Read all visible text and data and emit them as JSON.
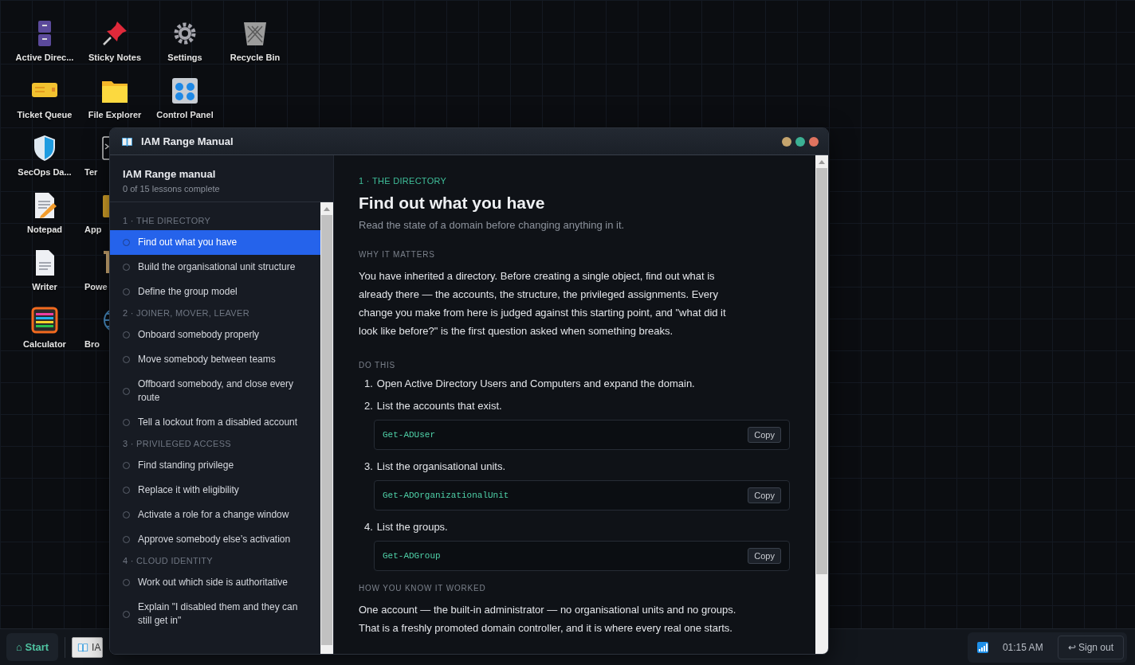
{
  "desktop_columns": [
    [
      {
        "label": "Active Direc...",
        "kind": "cabinet"
      },
      {
        "label": "Ticket Queue",
        "kind": "ticket"
      },
      {
        "label": "SecOps Da...",
        "kind": "shield"
      },
      {
        "label": "Notepad",
        "kind": "notepad"
      },
      {
        "label": "Writer",
        "kind": "document"
      },
      {
        "label": "Calculator",
        "kind": "abacus"
      }
    ],
    [
      {
        "label": "Sticky Notes",
        "kind": "pin",
        "partial": false
      },
      {
        "label": "File Explorer",
        "kind": "folder",
        "partial": false
      },
      {
        "label": "Ter",
        "kind": "terminal",
        "partial": true
      },
      {
        "label": "App",
        "kind": "box",
        "partial": true
      },
      {
        "label": "Powe",
        "kind": "scroll",
        "partial": true
      },
      {
        "label": "Bro",
        "kind": "globe",
        "partial": true
      }
    ],
    [
      {
        "label": "Settings",
        "kind": "gear"
      },
      {
        "label": "Control Panel",
        "kind": "panel"
      }
    ],
    [
      {
        "label": "Recycle Bin",
        "kind": "bin"
      }
    ]
  ],
  "window": {
    "title": "IAM Range Manual"
  },
  "sidebar": {
    "title": "IAM Range manual",
    "progress": "0 of 15 lessons complete",
    "groups": [
      {
        "label": "1 · THE DIRECTORY",
        "lessons": [
          {
            "title": "Find out what you have",
            "selected": true,
            "complete": false
          },
          {
            "title": "Build the organisational unit structure",
            "selected": false,
            "complete": false
          },
          {
            "title": "Define the group model",
            "selected": false,
            "complete": false
          }
        ]
      },
      {
        "label": "2 · JOINER, MOVER, LEAVER",
        "lessons": [
          {
            "title": "Onboard somebody properly",
            "selected": false,
            "complete": false
          },
          {
            "title": "Move somebody between teams",
            "selected": false,
            "complete": false
          },
          {
            "title": "Offboard somebody, and close every route",
            "selected": false,
            "complete": false
          },
          {
            "title": "Tell a lockout from a disabled account",
            "selected": false,
            "complete": false
          }
        ]
      },
      {
        "label": "3 · PRIVILEGED ACCESS",
        "lessons": [
          {
            "title": "Find standing privilege",
            "selected": false,
            "complete": false
          },
          {
            "title": "Replace it with eligibility",
            "selected": false,
            "complete": false
          },
          {
            "title": "Activate a role for a change window",
            "selected": false,
            "complete": false
          },
          {
            "title": "Approve somebody else’s activation",
            "selected": false,
            "complete": false
          }
        ]
      },
      {
        "label": "4 · CLOUD IDENTITY",
        "lessons": [
          {
            "title": "Work out which side is authoritative",
            "selected": false,
            "complete": false
          },
          {
            "title": "Explain \"I disabled them and they can still get in\"",
            "selected": false,
            "complete": false
          }
        ]
      }
    ]
  },
  "lesson": {
    "section": "1 · THE DIRECTORY",
    "title": "Find out what you have",
    "subtitle": "Read the state of a domain before changing anything in it.",
    "why_heading": "WHY IT MATTERS",
    "why_text": "You have inherited a directory. Before creating a single object, find out what is already there — the accounts, the structure, the privileged assignments. Every change you make from here is judged against this starting point, and \"what did it look like before?\" is the first question asked when something breaks.",
    "do_heading": "DO THIS",
    "steps": [
      {
        "number": "1.",
        "text": "Open Active Directory Users and Computers and expand the domain."
      },
      {
        "number": "2.",
        "text": "List the accounts that exist.",
        "code": "Get-ADUser",
        "copy": "Copy"
      },
      {
        "number": "3.",
        "text": "List the organisational units.",
        "code": "Get-ADOrganizationalUnit",
        "copy": "Copy"
      },
      {
        "number": "4.",
        "text": "List the groups.",
        "code": "Get-ADGroup",
        "copy": "Copy"
      }
    ],
    "check_heading": "HOW YOU KNOW IT WORKED",
    "check_text": "One account — the built-in administrator — no organisational units and no groups. That is a freshly promoted domain controller, and it is where every real one starts."
  },
  "taskbar": {
    "start": "⌂ Start",
    "task_label": "IA",
    "clock": "01:15 AM",
    "sign_out": "↩ Sign out"
  }
}
